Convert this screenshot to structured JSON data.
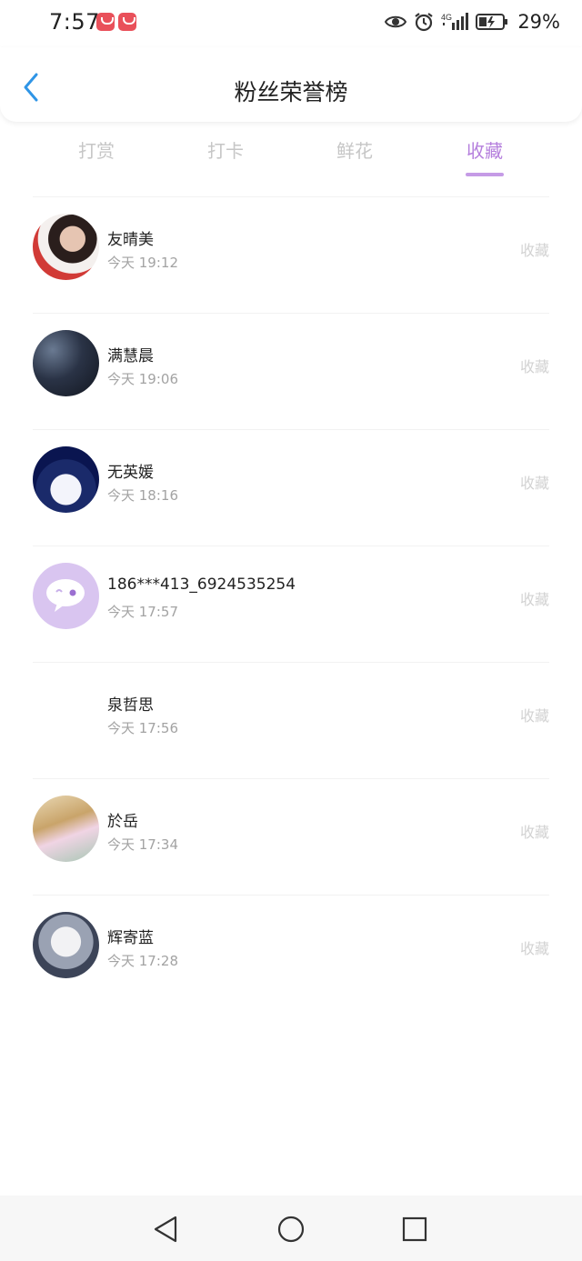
{
  "status_bar": {
    "time": "7:57",
    "battery_percent": "29%",
    "icons": [
      "app-icon",
      "app-icon",
      "eye-icon",
      "alarm-icon",
      "signal-4g-icon",
      "battery-icon"
    ]
  },
  "header": {
    "title": "粉丝荣誉榜",
    "accent_color": "#2f95e6"
  },
  "tabs": {
    "items": [
      {
        "label": "打赏"
      },
      {
        "label": "打卡"
      },
      {
        "label": "鲜花"
      },
      {
        "label": "收藏"
      }
    ],
    "active_index": 3,
    "active_color": "#b57fdd"
  },
  "fans": [
    {
      "name": "友晴美",
      "time": "今天 19:12",
      "action": "收藏"
    },
    {
      "name": "满慧晨",
      "time": "今天 19:06",
      "action": "收藏"
    },
    {
      "name": "无英媛",
      "time": "今天 18:16",
      "action": "收藏"
    },
    {
      "name": "186***413_6924535254",
      "time": "今天 17:57",
      "action": "收藏"
    },
    {
      "name": "泉哲思",
      "time": "今天 17:56",
      "action": "收藏"
    },
    {
      "name": "於岳",
      "time": "今天 17:34",
      "action": "收藏"
    },
    {
      "name": "辉寄蓝",
      "time": "今天 17:28",
      "action": "收藏"
    }
  ],
  "nav_bar": {
    "buttons": [
      "back-triangle-icon",
      "home-circle-icon",
      "recents-square-icon"
    ]
  }
}
